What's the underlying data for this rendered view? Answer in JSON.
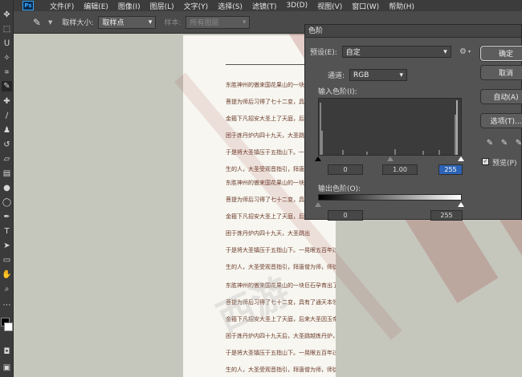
{
  "menubar": {
    "logo": "Ps",
    "items": [
      "文件(F)",
      "编辑(E)",
      "图像(I)",
      "图层(L)",
      "文字(Y)",
      "选择(S)",
      "滤镜(T)",
      "3D(D)",
      "视图(V)",
      "窗口(W)",
      "帮助(H)"
    ]
  },
  "options": {
    "sample_size_label": "取样大小:",
    "sample_size_value": "取样点",
    "sample_label": "样本:",
    "sample_value": "所有图层"
  },
  "document": {
    "paragraphs": [
      [
        "东胜神州的傲来国花果山的一块巨石",
        "菩提为师后习得了七十二变，具有了",
        "金箍下凡招安大圣上了天庭，后来大",
        "困于炼丹炉内四十九天，大圣跳出",
        "于是将大圣镇压于五指山下。一晃",
        "生的人，大圣受观音指引，拜唐僧"
      ],
      [
        "东胜神州的傲来国花果山的一块巨石",
        "菩提为师后习得了七十二变，具有了",
        "金箍下凡招安大圣上了天庭，后来大",
        "困于炼丹炉内四十九天，大圣跳出",
        "于是将大圣镇压于五指山下。一晃眼五百年过去了，唐僧被观世音菩萨选为西去取经普渡众",
        "生的人，大圣受观音指引，拜唐僧为师，师徒踏上了取经的路途。"
      ],
      [
        "东胜神州的傲来国花果山的一块巨石孕育出了一只明灵石猴（六小龄童 饰）。石猴后来拜须",
        "菩提为师后习得了七十二变，具有了通天本领，于是占山为王，自称齐天大圣。玉帝派太白",
        "金箍下凡招安大圣上了天庭，后来大圣因玉帝轻封的官职太低，大闹天宫，被太上老君",
        "困于炼丹炉内四十九天后，大圣跳越炼丹炉，炼成了金睛火眼。如来佛祖见局势不可收拾，",
        "于是将大圣镇压于五指山下。一晃眼五百年过去了，唐僧被观世音菩萨选为西去取经普渡众",
        "生的人，大圣受观音指引，拜唐僧为师，师徒踏上了取经的路途。"
      ]
    ],
    "watermark": "西游"
  },
  "levels_dialog": {
    "title": "色阶",
    "preset_label": "预设(E):",
    "preset_value": "自定",
    "channel_label": "通道:",
    "channel_value": "RGB",
    "input_levels_label": "输入色阶(I):",
    "input_black": "0",
    "input_gamma": "1.00",
    "input_white": "255",
    "output_levels_label": "输出色阶(O):",
    "output_black": "0",
    "output_white": "255",
    "buttons": {
      "ok": "确定",
      "cancel": "取消",
      "auto": "自动(A)",
      "options": "选项(T)..."
    },
    "preview_label": "预览(P)",
    "preview_checked": true
  },
  "colors": {
    "stripe": "#a03737",
    "foreground": "#000000",
    "background": "#ffffff"
  }
}
